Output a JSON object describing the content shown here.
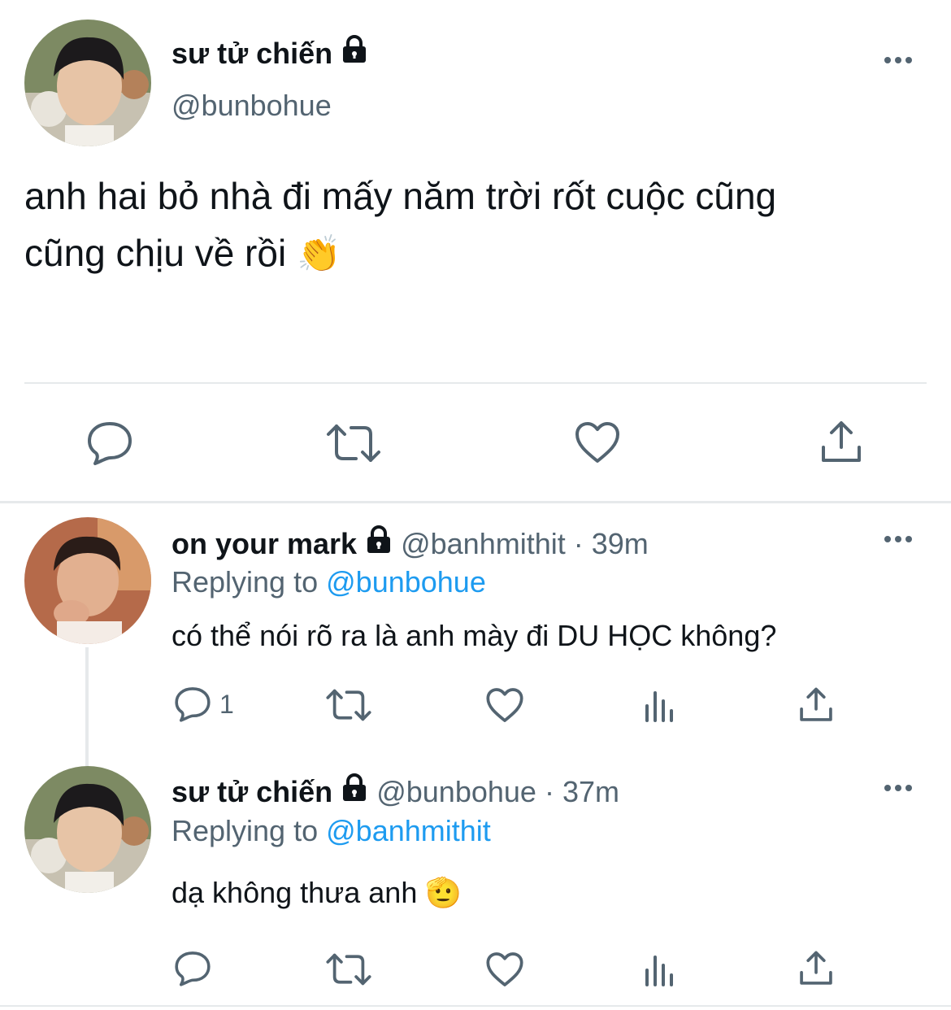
{
  "main_tweet": {
    "display_name": "sư tử chiến",
    "handle": "@bunbohue",
    "text_line1": "anh hai bỏ nhà đi mấy năm trời rốt cuộc cũng",
    "text_line2": "cũng chịu về rồi",
    "emoji": "👏",
    "avatar_icon": "avatar-user-photo"
  },
  "replies": [
    {
      "display_name": "on your mark",
      "handle": "@banhmithit",
      "time": "· 39m",
      "replying_prefix": "Replying to",
      "replying_handle": "@bunbohue",
      "text": "có thể nói rõ ra là anh mày đi DU HỌC không?",
      "reply_count": "1"
    },
    {
      "display_name": "sư tử chiến",
      "handle": "@bunbohue",
      "time": "· 37m",
      "replying_prefix": "Replying to",
      "replying_handle": "@banhmithit",
      "text": "dạ không thưa anh",
      "emoji": "🫡",
      "reply_count": ""
    }
  ],
  "colors": {
    "text": "#0f1419",
    "muted": "#536471",
    "link": "#1d9bf0",
    "divider": "#e6e9eb"
  }
}
